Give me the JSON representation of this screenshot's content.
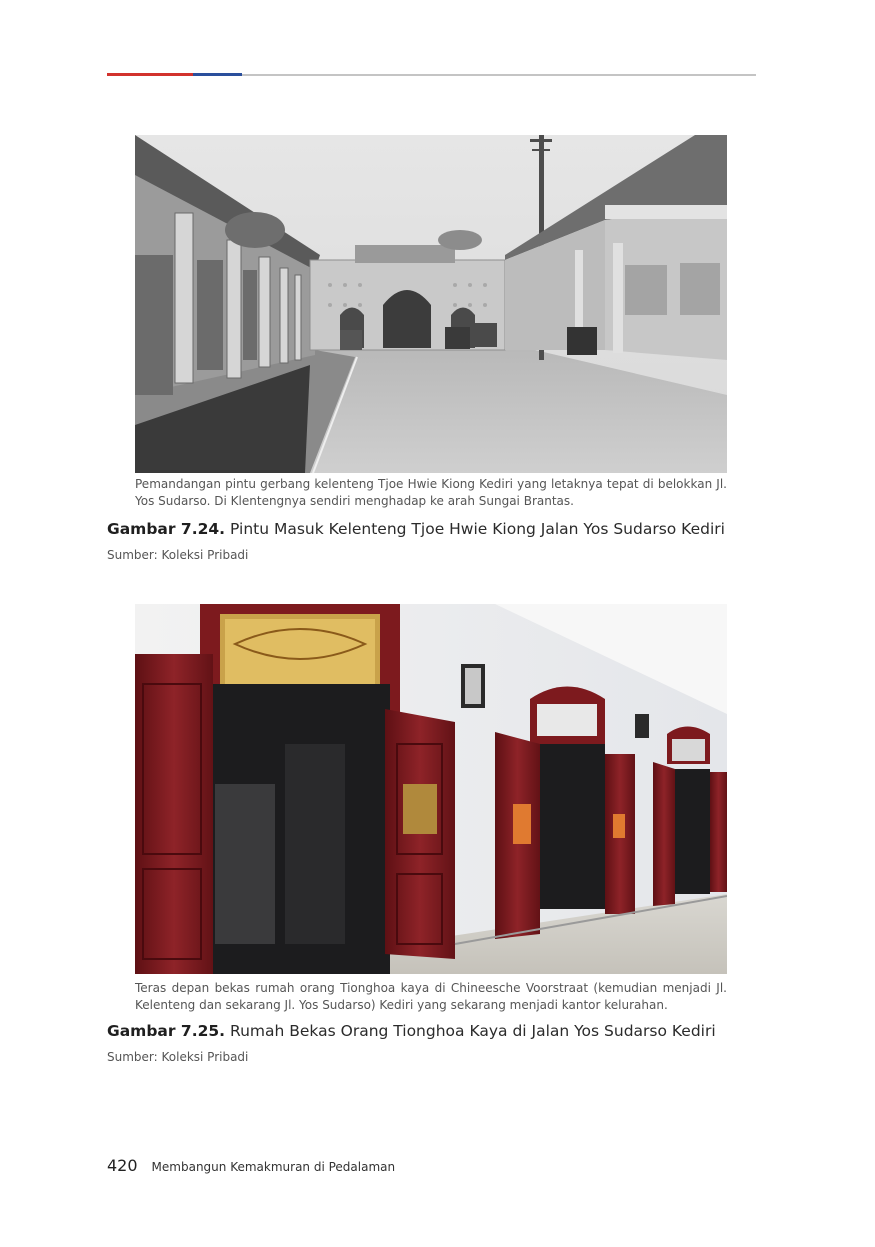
{
  "figures": [
    {
      "caption": "Pemandangan pintu gerbang kelenteng Tjoe Hwie Kiong Kediri yang letaknya tepat di belokkan Jl. Yos Sudarso. Di Klentengnya sendiri menghadap ke arah Sungai Brantas.",
      "label": "Gambar 7.24.",
      "title": "Pintu Masuk Kelenteng Tjoe Hwie Kiong Jalan Yos Sudarso Kediri",
      "source": "Sumber: Koleksi Pribadi"
    },
    {
      "caption": "Teras depan bekas rumah orang Tionghoa kaya di Chineesche Voorstraat (kemudian menjadi Jl. Kelenteng dan sekarang Jl. Yos Sudarso) Kediri yang sekarang menjadi kantor kelurahan.",
      "label": "Gambar 7.25.",
      "title": "Rumah Bekas Orang Tionghoa Kaya di Jalan Yos Sudarso Kediri",
      "source": "Sumber: Koleksi Pribadi"
    }
  ],
  "footer": {
    "page_number": "420",
    "book_title": "Membangun Kemakmuran di Pedalaman"
  },
  "colors": {
    "rule_red": "#d2322d",
    "rule_blue": "#2a4f9c",
    "rule_gray": "#c4c4c4",
    "door_red": "#7d1a1e"
  }
}
